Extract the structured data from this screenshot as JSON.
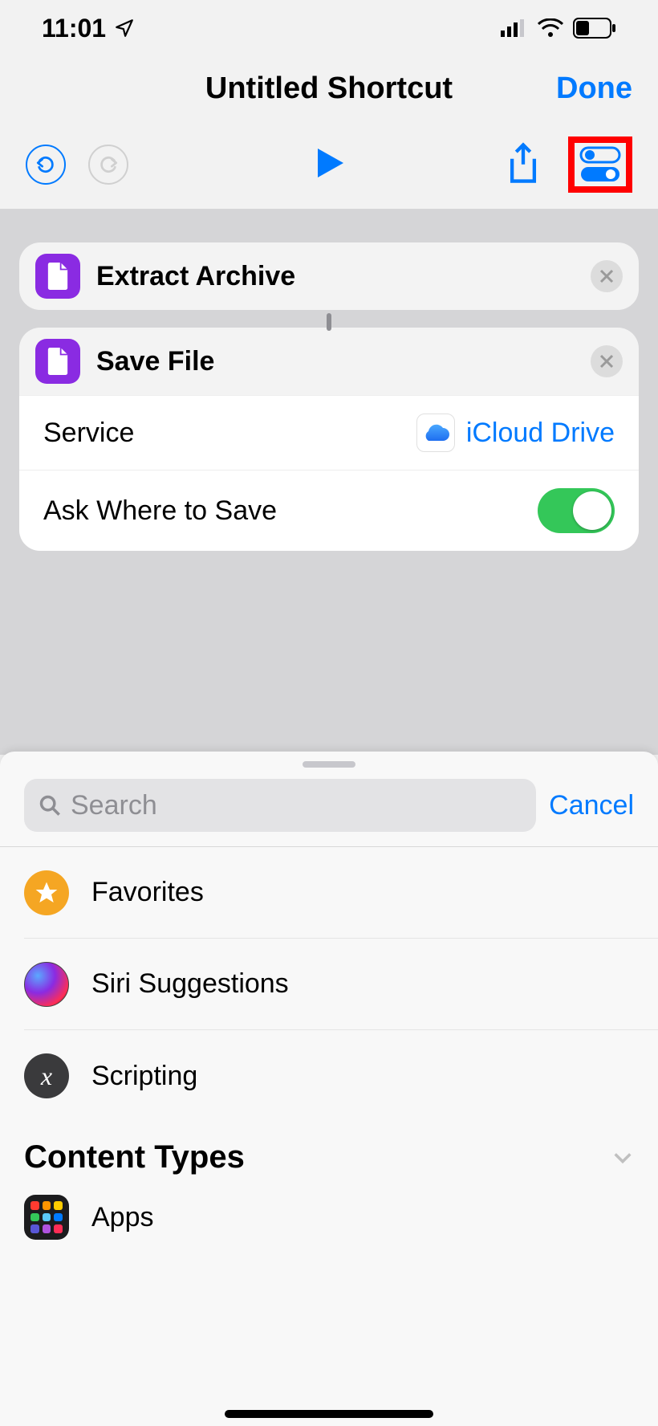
{
  "status": {
    "time": "11:01"
  },
  "nav": {
    "title": "Untitled Shortcut",
    "done": "Done"
  },
  "actions": [
    {
      "title": "Extract Archive",
      "icon": "document-icon",
      "color": "#8a2be2"
    },
    {
      "title": "Save File",
      "icon": "document-icon",
      "color": "#8a2be2",
      "params": {
        "service_label": "Service",
        "service_value": "iCloud Drive",
        "ask_label": "Ask Where to Save",
        "ask_value": true
      }
    }
  ],
  "drawer": {
    "search_placeholder": "Search",
    "cancel": "Cancel",
    "categories": [
      {
        "label": "Favorites",
        "icon": "star"
      },
      {
        "label": "Siri Suggestions",
        "icon": "siri"
      },
      {
        "label": "Scripting",
        "icon": "script"
      }
    ],
    "section_title": "Content Types",
    "apps_label": "Apps"
  }
}
